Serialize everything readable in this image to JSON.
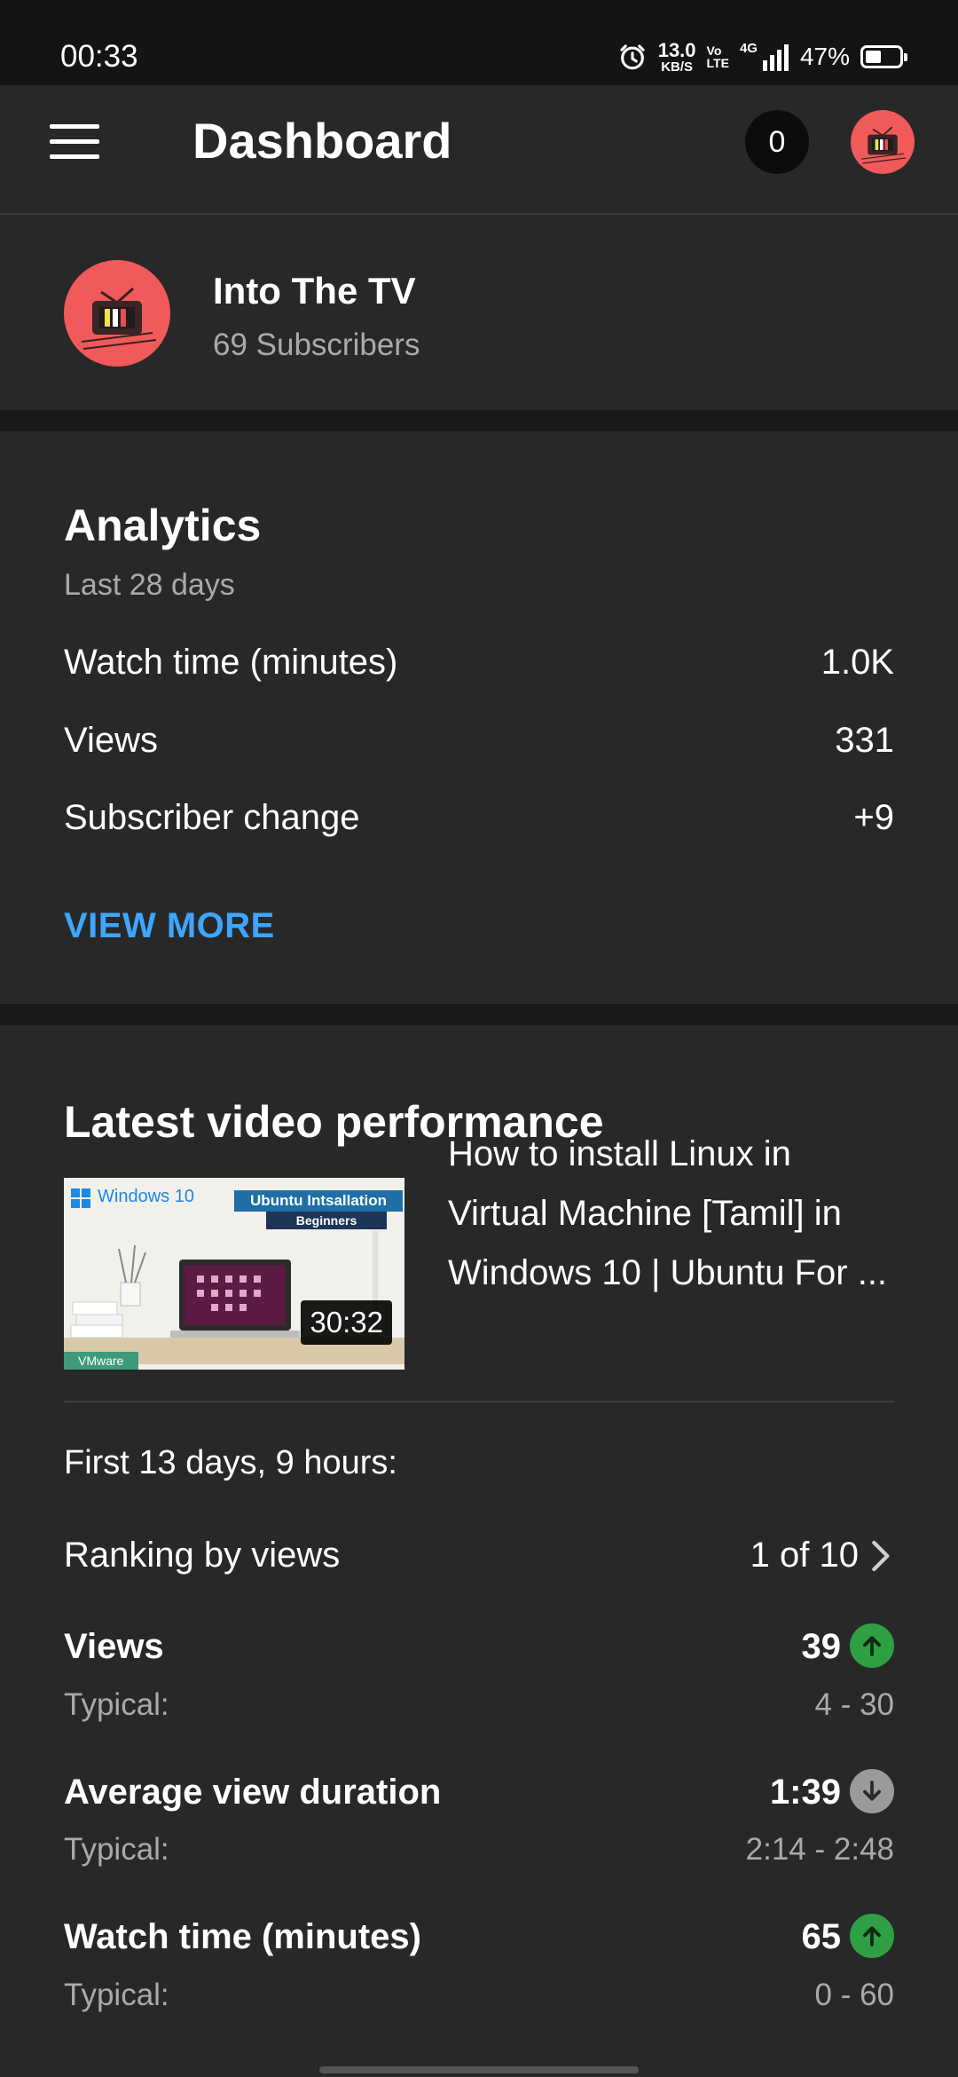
{
  "status_bar": {
    "time": "00:33",
    "net_speed": "13.0",
    "net_unit": "KB/S",
    "volte_top": "Vo",
    "volte_bottom": "LTE",
    "network": "4G",
    "battery": "47%",
    "battery_level": 0.47
  },
  "app_bar": {
    "title": "Dashboard",
    "notification_count": "0"
  },
  "channel": {
    "name": "Into The TV",
    "subscribers": "69 Subscribers"
  },
  "analytics": {
    "title": "Analytics",
    "period": "Last 28 days",
    "rows": [
      {
        "label": "Watch time (minutes)",
        "value": "1.0K"
      },
      {
        "label": "Views",
        "value": "331"
      },
      {
        "label": "Subscriber change",
        "value": "+9"
      }
    ],
    "view_more": "VIEW MORE"
  },
  "latest_video": {
    "title": "Latest video performance",
    "thumbnail": {
      "brand_text": "Windows 10",
      "tag_line1": "Ubuntu Intsallation",
      "tag_line2": "Beginners",
      "corner_tag": "VMware",
      "duration": "30:32"
    },
    "video_title_lines": [
      "How to install Linux in",
      "Virtual Machine [Tamil] in",
      "Windows 10 | Ubuntu For ..."
    ],
    "period": "First 13 days, 9 hours:",
    "ranking_label": "Ranking by views",
    "ranking_value": "1 of 10",
    "metrics": [
      {
        "label": "Views",
        "value": "39",
        "trend": "up",
        "typical_label": "Typical:",
        "typical_value": "4 - 30"
      },
      {
        "label": "Average view duration",
        "value": "1:39",
        "trend": "down",
        "typical_label": "Typical:",
        "typical_value": "2:14 - 2:48"
      },
      {
        "label": "Watch time (minutes)",
        "value": "65",
        "trend": "up",
        "typical_label": "Typical:",
        "typical_value": "0 - 60"
      }
    ]
  },
  "colors": {
    "background": "#282828",
    "separator": "#181818",
    "accent_link": "#3ea6ff",
    "trend_up": "#2ea043",
    "trend_down": "#9a9a9a",
    "secondary_text": "#aaaaaa"
  },
  "icons": {
    "menu": "hamburger-menu-icon",
    "alarm": "alarm-clock-icon",
    "signal": "signal-bars-icon",
    "battery": "battery-icon",
    "chevron": "chevron-right-icon",
    "trend_up": "arrow-up-icon",
    "trend_down": "arrow-down-icon"
  }
}
